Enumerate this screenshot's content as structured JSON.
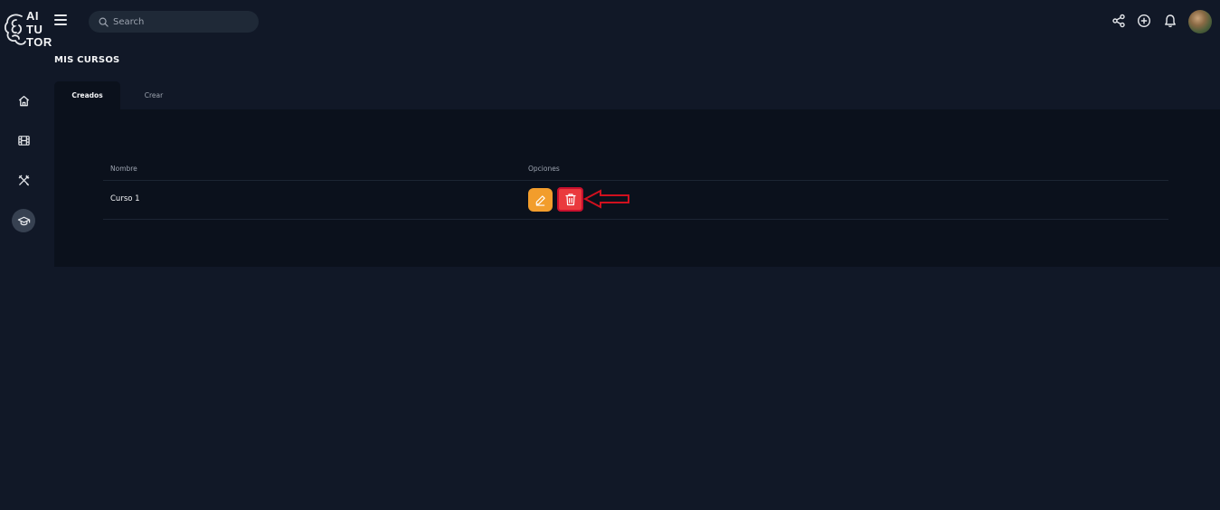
{
  "brand": {
    "logo_lines": [
      "AI",
      "TU",
      "TOR"
    ]
  },
  "header": {
    "search_placeholder": "Search",
    "icons": [
      "menu-icon",
      "share-icon",
      "plus-circle-icon",
      "bell-icon",
      "avatar"
    ]
  },
  "sidebar": {
    "items": [
      {
        "icon": "home-icon",
        "active": false
      },
      {
        "icon": "film-icon",
        "active": false
      },
      {
        "icon": "tools-icon",
        "active": false
      },
      {
        "icon": "graduation-cap-icon",
        "active": true
      }
    ]
  },
  "page": {
    "title": "MIS CURSOS",
    "tabs": [
      {
        "label": "Creados",
        "active": true
      },
      {
        "label": "Crear",
        "active": false
      }
    ]
  },
  "table": {
    "columns": [
      "Nombre",
      "Opciones"
    ],
    "rows": [
      {
        "name": "Curso 1",
        "actions": [
          "edit-icon",
          "trash-icon"
        ]
      }
    ]
  },
  "colors": {
    "background": "#111827",
    "panel": "#0b111c",
    "edit_button": "#f29d2c",
    "delete_button": "#ea3a3d",
    "annotation_arrow": "#d0101e"
  }
}
